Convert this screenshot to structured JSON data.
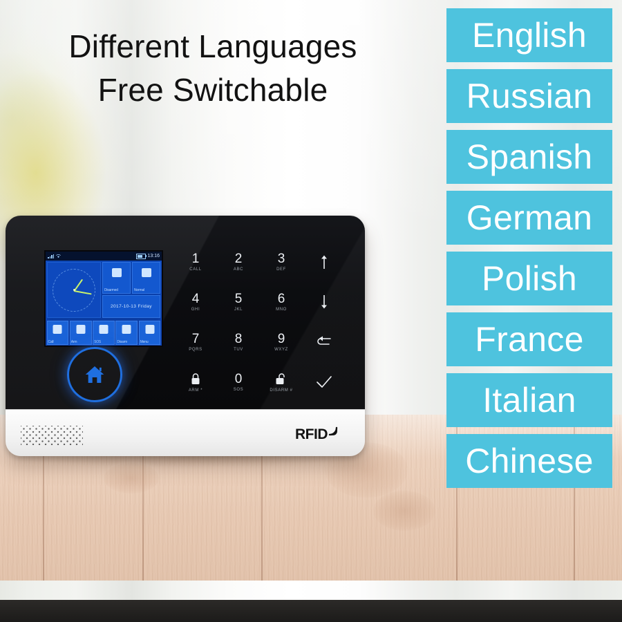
{
  "headline": {
    "line1": "Different Languages",
    "line2": "Free Switchable"
  },
  "languages": [
    {
      "label": "English"
    },
    {
      "label": "Russian"
    },
    {
      "label": "Spanish"
    },
    {
      "label": "German"
    },
    {
      "label": "Polish"
    },
    {
      "label": "France"
    },
    {
      "label": "Italian"
    },
    {
      "label": "Chinese"
    }
  ],
  "colors": {
    "badge_background": "#4ec3de",
    "badge_text": "#ffffff",
    "headline_text": "#121212",
    "panel_black": "#0c0d10",
    "panel_white": "#f3f3f3",
    "lcd_blue": "#0d47b5",
    "home_button_blue": "#1f6fe0"
  },
  "device": {
    "lcd": {
      "status_bar": {
        "signal_icon": "signal-bars-icon",
        "wifi_icon": "wifi-icon",
        "battery_icon": "battery-icon",
        "time": "13:16"
      },
      "clock_widget": "analog-clock",
      "tiles": [
        {
          "label": "Disarmed",
          "icon": "unlock-shield-icon"
        },
        {
          "label": "Normal",
          "icon": "status-normal-icon"
        }
      ],
      "date_bar": "2017-10-13 Friday",
      "function_keys": [
        {
          "label": "Call",
          "icon": "phone-icon"
        },
        {
          "label": "Arm",
          "icon": "lock-icon"
        },
        {
          "label": "SOS",
          "icon": "sos-icon"
        },
        {
          "label": "Disarm",
          "icon": "unlock-icon"
        },
        {
          "label": "Menu",
          "icon": "menu-list-icon"
        }
      ]
    },
    "home_button": {
      "icon": "home-icon"
    },
    "keypad": [
      {
        "num": "1",
        "sub": "CALL",
        "icon": ""
      },
      {
        "num": "2",
        "sub": "ABC",
        "icon": ""
      },
      {
        "num": "3",
        "sub": "DEF",
        "icon": ""
      },
      {
        "num": "",
        "sub": "",
        "icon": "arrow-up-icon"
      },
      {
        "num": "4",
        "sub": "GHI",
        "icon": ""
      },
      {
        "num": "5",
        "sub": "JKL",
        "icon": ""
      },
      {
        "num": "6",
        "sub": "MNO",
        "icon": ""
      },
      {
        "num": "",
        "sub": "",
        "icon": "arrow-down-icon"
      },
      {
        "num": "7",
        "sub": "PQRS",
        "icon": ""
      },
      {
        "num": "8",
        "sub": "TUV",
        "icon": ""
      },
      {
        "num": "9",
        "sub": "WXYZ",
        "icon": ""
      },
      {
        "num": "",
        "sub": "",
        "icon": "back-arrow-icon"
      },
      {
        "num": "",
        "sub": "ARM *",
        "icon": "lock-closed-icon"
      },
      {
        "num": "0",
        "sub": "SOS",
        "icon": ""
      },
      {
        "num": "",
        "sub": "DISARM #",
        "icon": "lock-open-icon"
      },
      {
        "num": "",
        "sub": "",
        "icon": "check-icon"
      }
    ],
    "branding": {
      "rfid_label": "RFID",
      "rfid_icon": "rfid-wave-icon"
    },
    "speaker_icon": "speaker-grille-icon"
  }
}
